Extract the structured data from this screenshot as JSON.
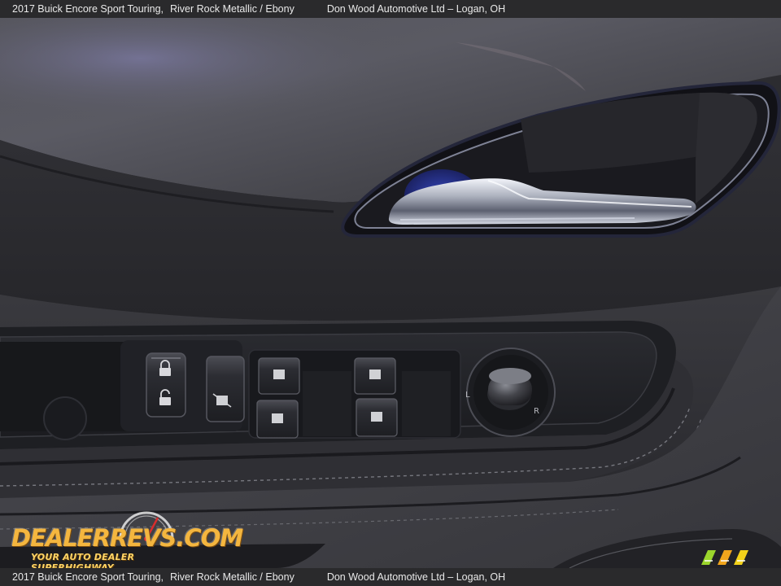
{
  "caption": {
    "vehicle": "2017 Buick Encore Sport Touring,",
    "color": "River Rock Metallic / Ebony",
    "dealer": "Don Wood Automotive Ltd – Logan, OH"
  },
  "watermark": {
    "brand": "DealerRevs.com",
    "brand_display": "DEALERREVS.COM",
    "tagline": "YOUR AUTO DEALER SUPERHIGHWAY"
  },
  "colors": {
    "caption_bg": "#2a2a2c",
    "caption_text": "#e9e9e9",
    "door_panel": "#4a4a4f",
    "leather": "#2c2c30",
    "chrome": "#c8ccd6",
    "watermark_gold": "#f4b63f"
  },
  "icons": [
    "door-lock-icon",
    "door-unlock-icon",
    "window-switch-icon",
    "mirror-control-knob-icon",
    "dealer-revs-gauge-icon"
  ]
}
